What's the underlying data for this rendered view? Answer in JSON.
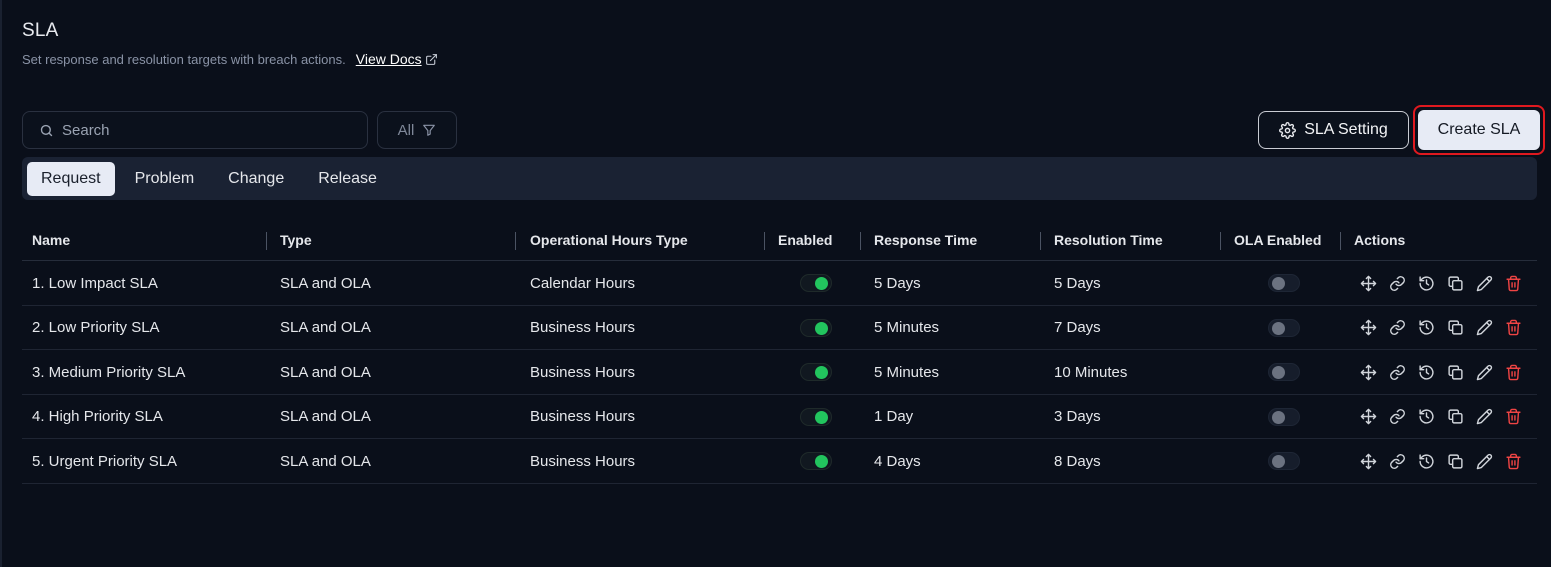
{
  "page": {
    "title": "SLA",
    "subtitle": "Set response and resolution targets with breach actions.",
    "docs_label": "View Docs"
  },
  "toolbar": {
    "search_placeholder": "Search",
    "filter_label": "All",
    "sla_setting_label": "SLA Setting",
    "create_label": "Create SLA"
  },
  "tabs": [
    {
      "label": "Request",
      "active": true
    },
    {
      "label": "Problem",
      "active": false
    },
    {
      "label": "Change",
      "active": false
    },
    {
      "label": "Release",
      "active": false
    }
  ],
  "table": {
    "columns": [
      "Name",
      "Type",
      "Operational Hours Type",
      "Enabled",
      "Response Time",
      "Resolution Time",
      "OLA Enabled",
      "Actions"
    ],
    "rows": [
      {
        "name": "1. Low Impact SLA",
        "type": "SLA and OLA",
        "hours": "Calendar Hours",
        "enabled": true,
        "response": "5 Days",
        "resolution": "5 Days",
        "ola": false
      },
      {
        "name": "2. Low Priority SLA",
        "type": "SLA and OLA",
        "hours": "Business Hours",
        "enabled": true,
        "response": "5 Minutes",
        "resolution": "7 Days",
        "ola": false
      },
      {
        "name": "3. Medium Priority SLA",
        "type": "SLA and OLA",
        "hours": "Business Hours",
        "enabled": true,
        "response": "5 Minutes",
        "resolution": "10 Minutes",
        "ola": false
      },
      {
        "name": "4. High Priority SLA",
        "type": "SLA and OLA",
        "hours": "Business Hours",
        "enabled": true,
        "response": "1 Day",
        "resolution": "3 Days",
        "ola": false
      },
      {
        "name": "5. Urgent Priority SLA",
        "type": "SLA and OLA",
        "hours": "Business Hours",
        "enabled": true,
        "response": "4 Days",
        "resolution": "8 Days",
        "ola": false
      }
    ],
    "action_icons": [
      "move-icon",
      "link-icon",
      "history-icon",
      "copy-icon",
      "edit-icon",
      "delete-icon"
    ]
  },
  "colors": {
    "background": "#0a0f1a",
    "toggle_on": "#22c55e",
    "toggle_off": "#6b7280",
    "delete": "#ef4444",
    "highlight": "#e0191f"
  }
}
